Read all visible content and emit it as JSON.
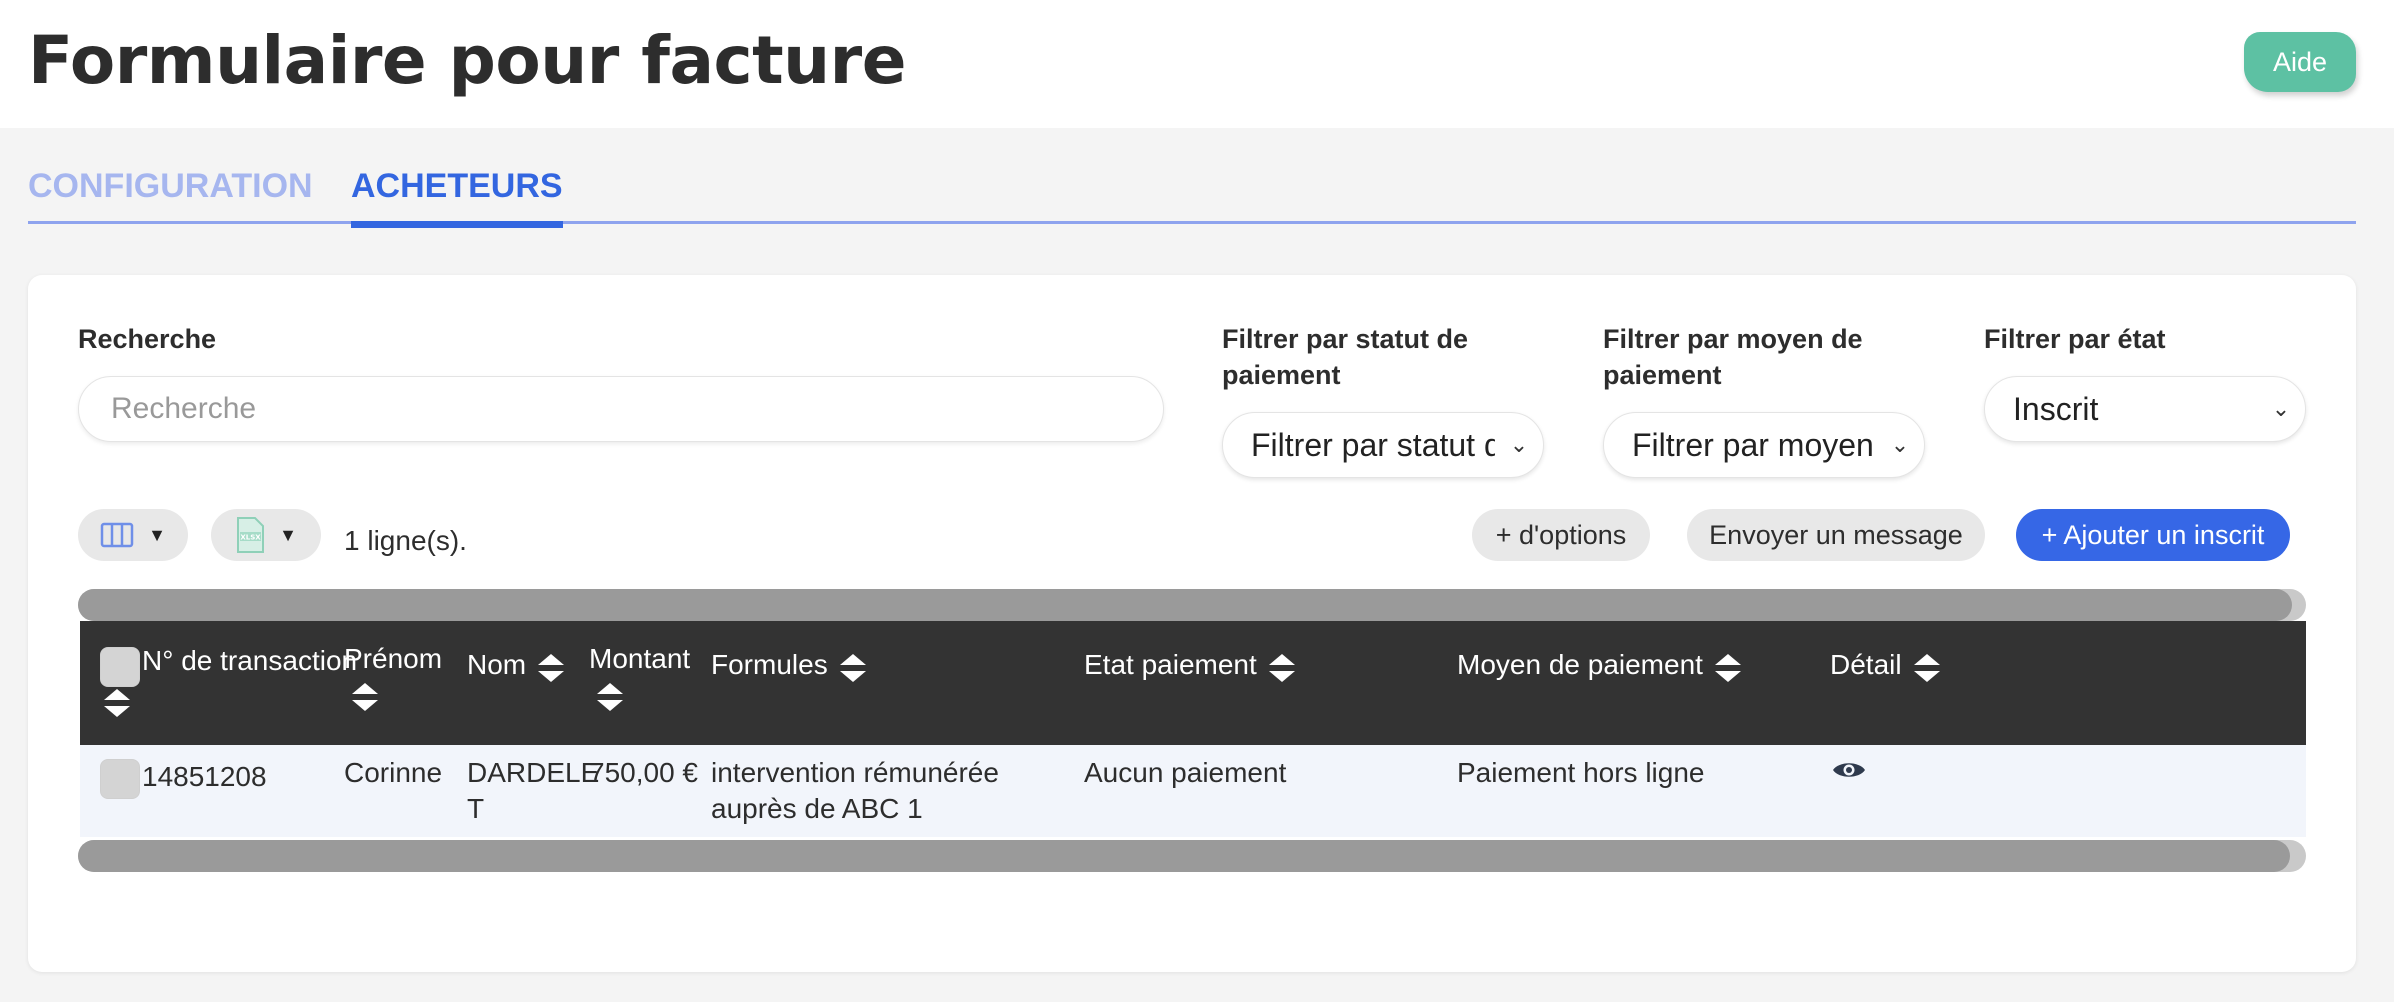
{
  "header": {
    "title": "Formulaire pour facture",
    "help_label": "Aide"
  },
  "tabs": [
    {
      "label": "CONFIGURATION",
      "active": false
    },
    {
      "label": "ACHETEURS",
      "active": true
    }
  ],
  "filters": {
    "search_label": "Recherche",
    "search_placeholder": "Recherche",
    "search_value": "",
    "payment_status_label": "Filtrer par statut de paiement",
    "payment_status_value": "Filtrer par statut de paiement",
    "payment_method_label": "Filtrer par moyen de paiement",
    "payment_method_value": "Filtrer par moyen de paiement",
    "state_label": "Filtrer par état",
    "state_value": "Inscrit"
  },
  "toolbar": {
    "row_count": "1 ligne(s).",
    "more_options": "+ d'options",
    "send_message": "Envoyer un message",
    "add_registrant": "+ Ajouter un inscrit",
    "columns_icon": "columns-icon",
    "export_icon": "xlsx-file-icon"
  },
  "table": {
    "columns": [
      "N° de transaction",
      "Prénom",
      "Nom",
      "Montant",
      "Formules",
      "Etat paiement",
      "Moyen de paiement",
      "Détail"
    ],
    "rows": [
      {
        "transaction": "14851208",
        "first_name": "Corinne",
        "last_name_1": "DARDELE",
        "last_name_2": "T",
        "amount": "750,00 €",
        "formula_1": "intervention rémunérée",
        "formula_2": "auprès de ABC 1",
        "payment_state": "Aucun paiement",
        "payment_method": "Paiement hors ligne",
        "detail_icon": "eye-icon"
      }
    ]
  },
  "colors": {
    "accent": "#3366e0",
    "help": "#5dc1a3",
    "table_header": "#333333"
  }
}
